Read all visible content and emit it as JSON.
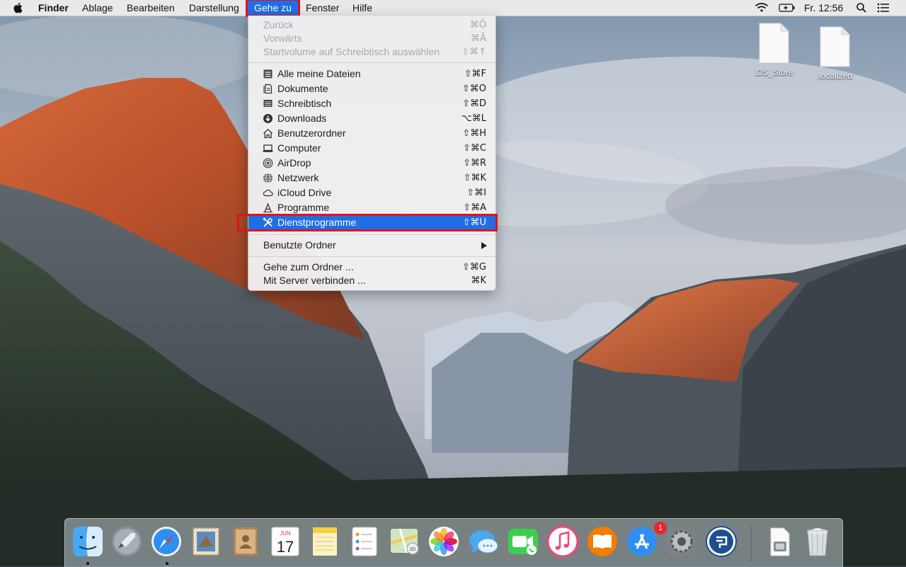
{
  "menubar": {
    "apple": "apple-logo",
    "app_name": "Finder",
    "menus": [
      "Ablage",
      "Bearbeiten",
      "Darstellung",
      "Gehe zu",
      "Fenster",
      "Hilfe"
    ],
    "clock": "Fr. 12:56"
  },
  "desktop_icons": [
    {
      "name": ".DS_Store"
    },
    {
      "name": ".localized"
    }
  ],
  "goto_menu": {
    "nav": [
      {
        "label": "Zurück",
        "shortcut": "⌘Ö",
        "enabled": false
      },
      {
        "label": "Vorwärts",
        "shortcut": "⌘Ä",
        "enabled": false
      },
      {
        "label": "Startvolume auf Schreibtisch auswählen",
        "shortcut": "⇧⌘↑",
        "enabled": false
      }
    ],
    "places": [
      {
        "label": "Alle meine Dateien",
        "shortcut": "⇧⌘F",
        "icon": "all-files-icon"
      },
      {
        "label": "Dokumente",
        "shortcut": "⇧⌘O",
        "icon": "documents-icon"
      },
      {
        "label": "Schreibtisch",
        "shortcut": "⇧⌘D",
        "icon": "desktop-icon"
      },
      {
        "label": "Downloads",
        "shortcut": "⌥⌘L",
        "icon": "downloads-icon"
      },
      {
        "label": "Benutzerordner",
        "shortcut": "⇧⌘H",
        "icon": "home-icon"
      },
      {
        "label": "Computer",
        "shortcut": "⇧⌘C",
        "icon": "computer-icon"
      },
      {
        "label": "AirDrop",
        "shortcut": "⇧⌘R",
        "icon": "airdrop-icon"
      },
      {
        "label": "Netzwerk",
        "shortcut": "⇧⌘K",
        "icon": "network-icon"
      },
      {
        "label": "iCloud Drive",
        "shortcut": "⇧⌘I",
        "icon": "icloud-icon"
      },
      {
        "label": "Programme",
        "shortcut": "⇧⌘A",
        "icon": "applications-icon"
      },
      {
        "label": "Dienstprogramme",
        "shortcut": "⇧⌘U",
        "icon": "utilities-icon",
        "selected": true
      }
    ],
    "recent": {
      "label": "Benutzte Ordner",
      "submenu": true
    },
    "folder": [
      {
        "label": "Gehe zum Ordner ...",
        "shortcut": "⇧⌘G"
      },
      {
        "label": "Mit Server verbinden ...",
        "shortcut": "⌘K"
      }
    ]
  },
  "dock": {
    "items": [
      "finder",
      "launchpad",
      "safari",
      "mail",
      "contacts",
      "calendar",
      "notes",
      "reminders",
      "maps",
      "photos",
      "messages",
      "facetime",
      "itunes",
      "ibooks",
      "app-store",
      "system-preferences",
      "migration-assistant",
      "downloads-stack",
      "trash"
    ],
    "calendar_month": "JUN",
    "calendar_day": "17",
    "appstore_badge": "1",
    "running": [
      "finder",
      "safari"
    ]
  },
  "colors": {
    "selection": "#1e6fe6",
    "highlight_box": "#e0131c"
  }
}
